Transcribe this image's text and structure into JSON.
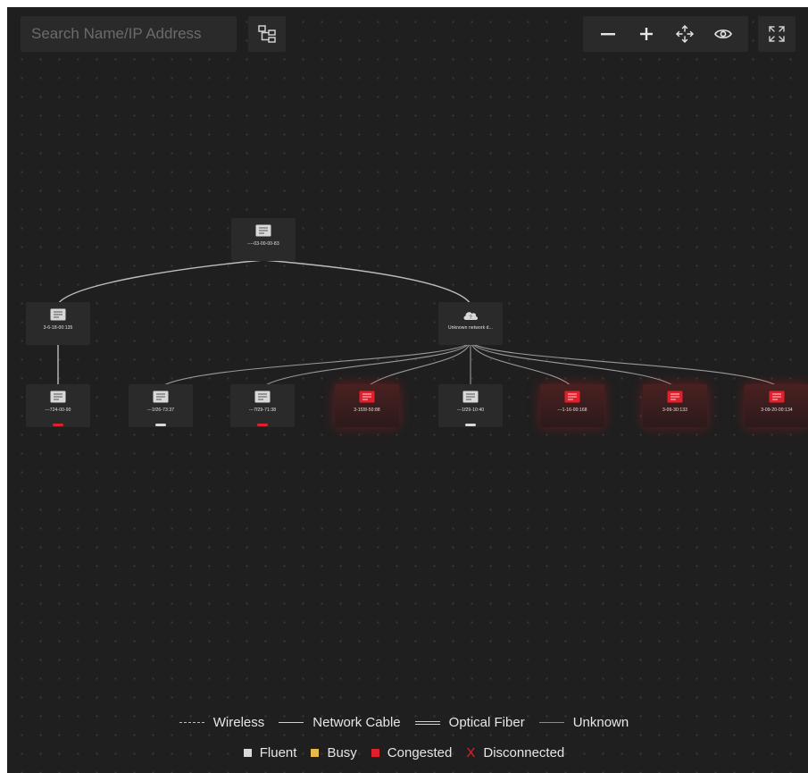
{
  "search": {
    "placeholder": "Search Name/IP Address"
  },
  "toolbar": {
    "layout_icon": "topology-layout-icon",
    "zoom_out_icon": "minus-icon",
    "zoom_in_icon": "plus-icon",
    "fit_icon": "move-arrows-icon",
    "view_icon": "eye-icon",
    "fullscreen_icon": "fullscreen-icon"
  },
  "colors": {
    "background": "#1f1f1f",
    "panel": "#2a2a2a",
    "fluent": "#d9d9d9",
    "busy": "#e7b84a",
    "congested": "#e0202c",
    "disconnected": "#e0202c"
  },
  "nodes": [
    {
      "id": "root",
      "label": "----03-00-00-83",
      "type": "switch",
      "state": "normal"
    },
    {
      "id": "left",
      "label": "3-6-18-00:135",
      "type": "switch",
      "state": "normal"
    },
    {
      "id": "unknown",
      "label": "Unknown network d...",
      "type": "cloud",
      "state": "normal"
    },
    {
      "id": "c1",
      "label": "---724-00-90",
      "type": "switch",
      "state": "normal",
      "port": "congested"
    },
    {
      "id": "c2",
      "label": "---1f26-73:37",
      "type": "switch",
      "state": "normal",
      "port": "fluent"
    },
    {
      "id": "c3",
      "label": "---7f29-71:38",
      "type": "switch",
      "state": "normal",
      "port": "congested"
    },
    {
      "id": "c4",
      "label": "3-1f28-50:88",
      "type": "switch",
      "state": "congested"
    },
    {
      "id": "c5",
      "label": "---1f29-10:40",
      "type": "switch",
      "state": "normal",
      "port": "fluent"
    },
    {
      "id": "c6",
      "label": "---1-16-00:168",
      "type": "switch",
      "state": "congested"
    },
    {
      "id": "c7",
      "label": "3-09-30:133",
      "type": "switch",
      "state": "congested"
    },
    {
      "id": "c8",
      "label": "3-09-20-00:134",
      "type": "switch",
      "state": "congested"
    }
  ],
  "legend": {
    "wireless": "Wireless",
    "network_cable": "Network Cable",
    "optical_fiber": "Optical Fiber",
    "unknown": "Unknown",
    "fluent": "Fluent",
    "busy": "Busy",
    "congested": "Congested",
    "disconnected_mark": "X",
    "disconnected": "Disconnected"
  }
}
